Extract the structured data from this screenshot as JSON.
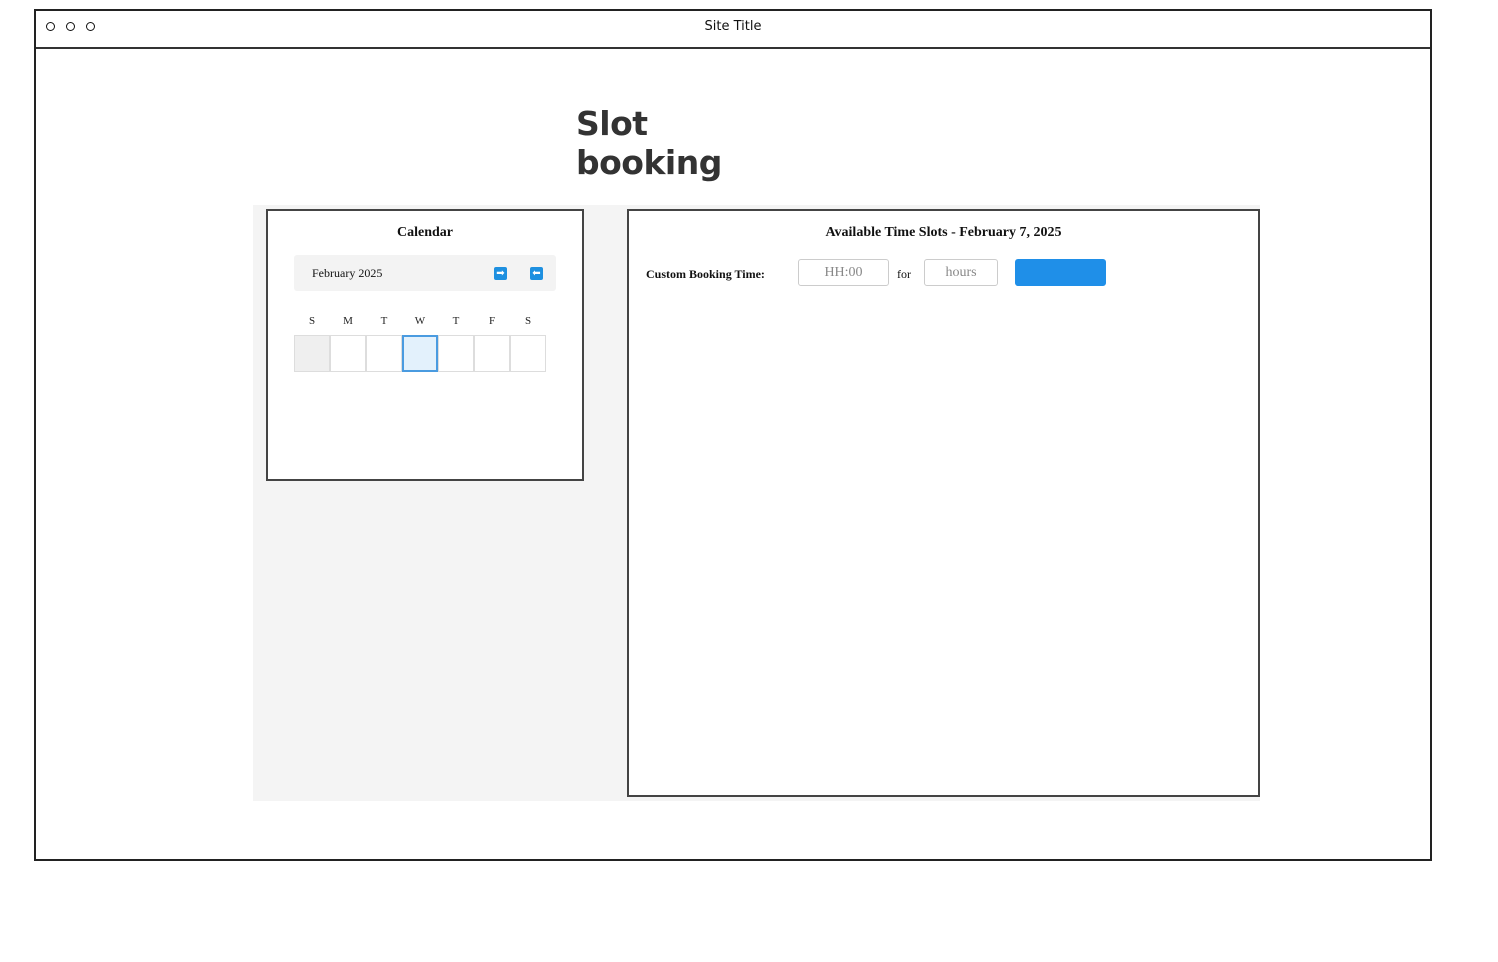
{
  "window": {
    "title": "Site Title"
  },
  "page": {
    "heading": "Slot booking"
  },
  "calendar": {
    "title": "Calendar",
    "month_label": "February 2025",
    "next_icon": "arrow-right-icon",
    "prev_icon": "arrow-left-icon",
    "weekdays": [
      "S",
      "M",
      "T",
      "W",
      "T",
      "F",
      "S"
    ],
    "selected_day_index": 3,
    "muted_day_index": 0
  },
  "slots": {
    "title": "Available Time Slots - February 7, 2025",
    "custom_label": "Custom Booking Time:",
    "time_placeholder": "HH:00",
    "for_label": "for",
    "hours_placeholder": "hours",
    "button_label": ""
  },
  "colors": {
    "accent": "#1f8fe8",
    "selected_day_bg": "#e3f1fc",
    "selected_day_border": "#4a9be0",
    "app_background": "#f4f4f4"
  }
}
